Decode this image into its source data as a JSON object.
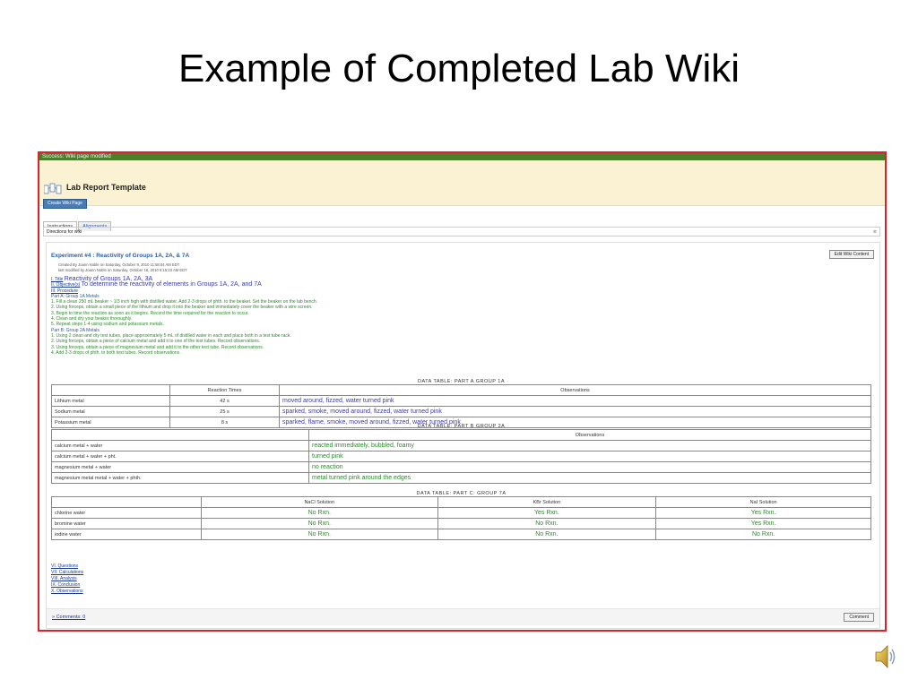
{
  "slide": {
    "title": "Example of Completed Lab Wiki"
  },
  "success": "Success: Wiki page modified",
  "header": {
    "title": "Lab Report Template",
    "create_btn": "Create Wiki Page"
  },
  "tabs": [
    {
      "label": "Instructions"
    },
    {
      "label": "Alignments"
    }
  ],
  "directions": {
    "label": "Directions for wiki",
    "close": "⊗"
  },
  "panel": {
    "exp_title": "Experiment #4 : Reactivity of Groups 1A, 2A, & 7A",
    "edit_btn": "Edit Wiki Content",
    "meta1": "Created By Joann Noble on Saturday, October 9, 2010 11:58:04 AM EDT",
    "meta2": "last modified by Joann Noble on Saturday, October 16, 2010 9:15:23 AM EDT",
    "title_label": "I. Title",
    "title_text": "Reactivity of Groups 1A, 2A, 3A",
    "obj_label": "II. Objective(s)",
    "obj_text": "To determine the reactivity of elements in Groups 1A, 2A, and 7A",
    "proc_label": "III. Procedure",
    "partA": "Part A: Group 1A Metals",
    "steps_a": [
      "1. Fill a clean 250 mL beaker ~ 1/3 inch high with distilled water. Add 2-3 drops of phth. to the beaker. Set the beaker on the lab bench.",
      "2. Using forceps, obtain a small piece of the lithium and drop it into the beaker and immediately cover the beaker with a wire screen.",
      "3. Begin to time the reaction as soon as it begins. Record the time required for the reaction to occur.",
      "4. Clean and dry your beaker thoroughly.",
      "5. Repeat steps 1-4 using sodium and potassium metals."
    ],
    "partB": "Part B: Group 2A Metals",
    "steps_b": [
      "1. Using 2 clean and dry test tubes, place approximately 5 mL of distilled water in each and place both in a test tube rack.",
      "2. Using forceps, obtain a piece of calcium metal and add it to one of the test tubes. Record observations.",
      "3. Using forceps, obtain a piece of magnesium metal and add it to the other test tube. Record observations.",
      "4. Add 2-3 drops of phth. to both test tubes. Record observations."
    ]
  },
  "tableA": {
    "caption": "DATA TABLE: PART A GROUP 1A",
    "headers": [
      "",
      "Reaction Times",
      "Observations"
    ],
    "rows": [
      [
        "Lithium metal",
        "42 s",
        "moved around, fizzed, water turned pink"
      ],
      [
        "Sodium metal",
        "25 s",
        "sparked, smoke, moved around, fizzed, water turned pink"
      ],
      [
        "Potassium metal",
        "8 s",
        "sparked, flame, smoke, moved around, fizzed, water turned pink"
      ]
    ]
  },
  "tableB": {
    "caption": "DATA TABLE: PART B GROUP 2A",
    "headers": [
      "",
      "Observations"
    ],
    "rows": [
      [
        "calcium metal + water",
        "reacted immediately, bubbled, foamy"
      ],
      [
        "calcium metal + water + pht.",
        "turned pink"
      ],
      [
        "magnesium metal + water",
        "no reaction"
      ],
      [
        "magnesium metal metal + water + phth.",
        "metal turned pink around the edges"
      ]
    ]
  },
  "tableC": {
    "caption": "DATA TABLE: PART C: GROUP 7A",
    "headers": [
      "",
      "NaCl Solution",
      "KBr Solution",
      "NaI Solution"
    ],
    "rows": [
      [
        "chlorine water",
        "No Rxn.",
        "Yes Rxn.",
        "Yes Rxn."
      ],
      [
        "bromine water",
        "No Rxn.",
        "No Rxn.",
        "Yes Rxn."
      ],
      [
        "iodine water",
        "No Rxn.",
        "No Rxn.",
        "No Rxn."
      ]
    ]
  },
  "links": [
    "VI. Questions",
    "VII. Calculations",
    "VIII. Analysis",
    "IX. Conclusion",
    "X. Observations"
  ],
  "comments": {
    "link": "» Comments: 0",
    "button": "Comment"
  },
  "colors": {
    "frame": "#d8232a",
    "success": "#4b7f2a",
    "header_bg": "#fbf2d4",
    "obs_blue": "#3b3bb0",
    "green": "#2d8a2d"
  }
}
